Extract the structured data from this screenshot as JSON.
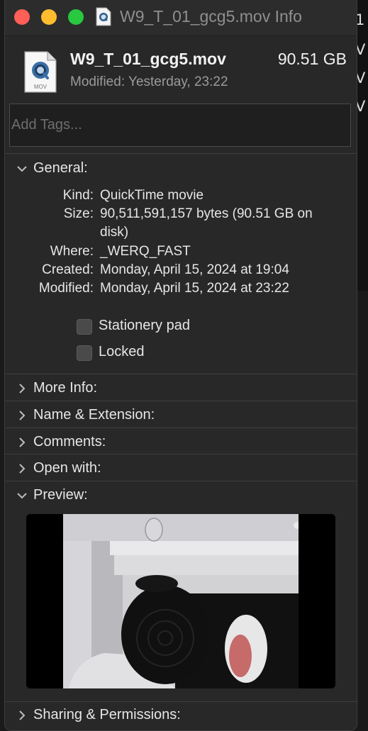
{
  "background": {
    "edge_chars": [
      "1",
      "V",
      "V",
      "V"
    ]
  },
  "window": {
    "title": "W9_T_01_gcg5.mov Info"
  },
  "file": {
    "name": "W9_T_01_gcg5.mov",
    "size": "90.51 GB",
    "modified": "Modified: Yesterday, 23:22",
    "icon_label": "MOV"
  },
  "tags": {
    "placeholder": "Add Tags..."
  },
  "general": {
    "label": "General:",
    "kind_label": "Kind:",
    "kind": "QuickTime movie",
    "size_label": "Size:",
    "size": "90,511,591,157 bytes (90.51 GB on disk)",
    "where_label": "Where:",
    "where": "_WERQ_FAST",
    "created_label": "Created:",
    "created": "Monday, April 15, 2024 at 19:04",
    "modified_label": "Modified:",
    "modified": "Monday, April 15, 2024 at 23:22",
    "stationery_label": "Stationery pad",
    "locked_label": "Locked"
  },
  "sections": {
    "more_info": "More Info:",
    "name_extension": "Name & Extension:",
    "comments": "Comments:",
    "open_with": "Open with:",
    "preview": "Preview:",
    "sharing": "Sharing & Permissions:"
  },
  "colors": {
    "window_bg": "#282828",
    "close": "#fe5f57",
    "minimize": "#febc2e",
    "zoom": "#28c840"
  }
}
